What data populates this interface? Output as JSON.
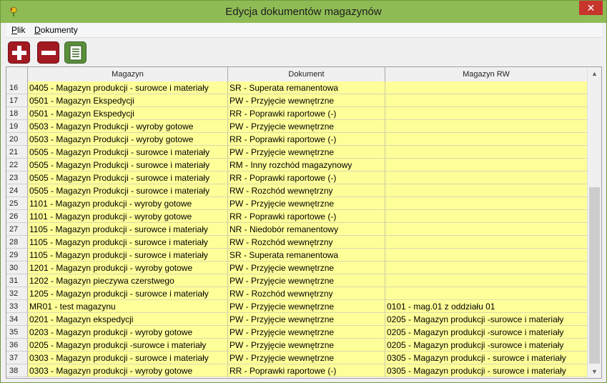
{
  "window": {
    "title": "Edycja dokumentów magazynów",
    "close_glyph": "✕"
  },
  "menu": [
    {
      "label_ul": "P",
      "label_rest": "lik"
    },
    {
      "label_ul": "D",
      "label_rest": "okumenty"
    }
  ],
  "toolbar": {
    "add_icon": "plus-icon",
    "delete_icon": "minus-icon",
    "document_icon": "document-icon"
  },
  "colors": {
    "row_bg": "#ffff99",
    "titlebar": "#8fbb55",
    "button_red": "#a31a22",
    "button_green": "#5a8e3a"
  },
  "table": {
    "columns": [
      "Magazyn",
      "Dokument",
      "Magazyn RW"
    ],
    "rows": [
      {
        "num": "16",
        "magazyn": "0405 - Magazyn produkcji - surowce i materiały",
        "dokument": "SR - Superata remanentowa",
        "rw": ""
      },
      {
        "num": "17",
        "magazyn": "0501 - Magazyn Ekspedycji",
        "dokument": "PW - Przyjęcie wewnętrzne",
        "rw": ""
      },
      {
        "num": "18",
        "magazyn": "0501 - Magazyn Ekspedycji",
        "dokument": "RR - Poprawki raportowe (-)",
        "rw": ""
      },
      {
        "num": "19",
        "magazyn": "0503 - Magazyn Produkcji - wyroby gotowe",
        "dokument": "PW - Przyjęcie wewnętrzne",
        "rw": ""
      },
      {
        "num": "20",
        "magazyn": "0503 - Magazyn Produkcji - wyroby gotowe",
        "dokument": "RR - Poprawki raportowe (-)",
        "rw": ""
      },
      {
        "num": "21",
        "magazyn": "0505 - Magazyn Produkcji - surowce i materiały",
        "dokument": "PW - Przyjęcie wewnętrzne",
        "rw": ""
      },
      {
        "num": "22",
        "magazyn": "0505 - Magazyn Produkcji - surowce i materiały",
        "dokument": "RM - Inny rozchód magazynowy",
        "rw": ""
      },
      {
        "num": "23",
        "magazyn": "0505 - Magazyn Produkcji - surowce i materiały",
        "dokument": "RR - Poprawki raportowe (-)",
        "rw": ""
      },
      {
        "num": "24",
        "magazyn": "0505 - Magazyn Produkcji - surowce i materiały",
        "dokument": "RW - Rozchód wewnętrzny",
        "rw": ""
      },
      {
        "num": "25",
        "magazyn": "1101 - Magazyn produkcji - wyroby gotowe",
        "dokument": "PW - Przyjęcie wewnętrzne",
        "rw": ""
      },
      {
        "num": "26",
        "magazyn": "1101 - Magazyn produkcji - wyroby gotowe",
        "dokument": "RR - Poprawki raportowe (-)",
        "rw": ""
      },
      {
        "num": "27",
        "magazyn": "1105 - Magazyn produkcji - surowce i materiały",
        "dokument": "NR - Niedobór remanentowy",
        "rw": ""
      },
      {
        "num": "28",
        "magazyn": "1105 - Magazyn produkcji - surowce i materiały",
        "dokument": "RW - Rozchód wewnętrzny",
        "rw": ""
      },
      {
        "num": "29",
        "magazyn": "1105 - Magazyn produkcji - surowce i materiały",
        "dokument": "SR - Superata remanentowa",
        "rw": ""
      },
      {
        "num": "30",
        "magazyn": "1201 - Magazyn produkcji - wyroby gotowe",
        "dokument": "PW - Przyjęcie wewnętrzne",
        "rw": ""
      },
      {
        "num": "31",
        "magazyn": "1202 - Magazyn pieczywa czerstwego",
        "dokument": "PW - Przyjęcie wewnętrzne",
        "rw": ""
      },
      {
        "num": "32",
        "magazyn": "1205 - Magazyn produkcji - surowce i materiały",
        "dokument": "RW - Rozchód wewnętrzny",
        "rw": ""
      },
      {
        "num": "33",
        "magazyn": "MR01 - test magazynu",
        "dokument": "PW - Przyjęcie wewnętrzne",
        "rw": "0101 - mag.01 z oddziału 01"
      },
      {
        "num": "34",
        "magazyn": "0201 - Magazyn ekspedycji",
        "dokument": "PW - Przyjęcie wewnętrzne",
        "rw": "0205 - Magazyn produkcji -surowce i materiały"
      },
      {
        "num": "35",
        "magazyn": "0203 - Magazyn produkcji - wyroby gotowe",
        "dokument": "PW - Przyjęcie wewnętrzne",
        "rw": "0205 - Magazyn produkcji -surowce i materiały"
      },
      {
        "num": "36",
        "magazyn": "0205 - Magazyn produkcji -surowce i materiały",
        "dokument": "PW - Przyjęcie wewnętrzne",
        "rw": "0205 - Magazyn produkcji -surowce i materiały"
      },
      {
        "num": "37",
        "magazyn": "0303 - Magazyn produkcji - surowce i materiały",
        "dokument": "PW - Przyjęcie wewnętrzne",
        "rw": "0305 - Magazyn produkcji - surowce i materiały"
      },
      {
        "num": "38",
        "magazyn": "0303 - Magazyn produkcji - wyroby gotowe",
        "dokument": "RR - Poprawki raportowe (-)",
        "rw": "0305 - Magazyn produkcji - surowce i materiały"
      }
    ]
  }
}
